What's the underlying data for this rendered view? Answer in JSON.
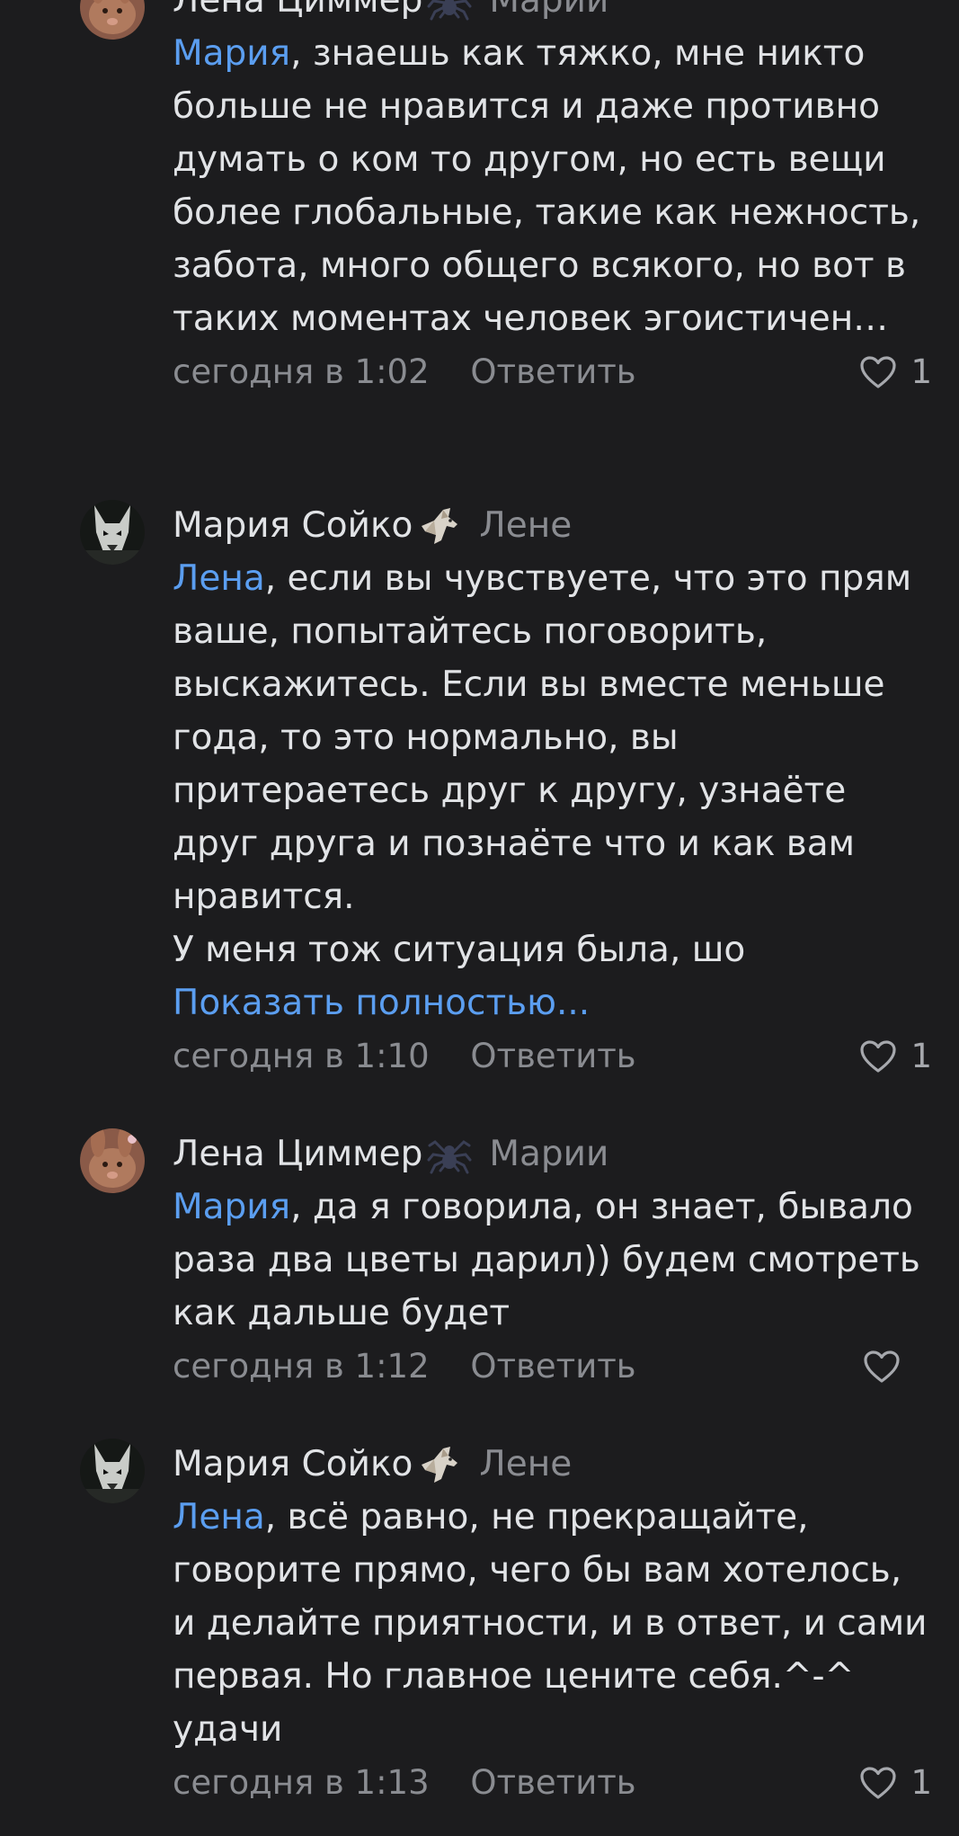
{
  "comments": [
    {
      "author": "Лена Циммер",
      "reply_to": "Марии",
      "mention": "Мария",
      "text": ", знаешь как тяжко, мне никто больше не нравится и даже противно думать о ком то другом, но есть вещи более глобальные, такие как нежность, забота, много общего всякого, но вот в таких моментах человек эгоистичен…",
      "time": "сегодня в 1:02",
      "reply_label": "Ответить",
      "likes": "1",
      "avatar_icon": "rabbit-avatar",
      "badge_icon": "spider-icon"
    },
    {
      "author": "Мария Сойко",
      "reply_to": "Лене",
      "mention": "Лена",
      "text": ", если вы чувствуете, что это прям ваше, попытайтесь поговорить, выскажитесь. Если вы вместе меньше года, то это нормально, вы притераетесь друг к другу, узнаёте друг друга и познаёте что и как вам нравится.\nУ меня тож ситуация была, шо",
      "show_more": "Показать полностью...",
      "time": "сегодня в 1:10",
      "reply_label": "Ответить",
      "likes": "1",
      "avatar_icon": "wolf-avatar",
      "badge_icon": "wolf-icon"
    },
    {
      "author": "Лена Циммер",
      "reply_to": "Марии",
      "mention": "Мария",
      "text": ", да я говорила, он знает, бывало раза два цветы дарил)) будем смотреть как дальше будет",
      "time": "сегодня в 1:12",
      "reply_label": "Ответить",
      "likes": "",
      "avatar_icon": "rabbit-avatar",
      "badge_icon": "spider-icon"
    },
    {
      "author": "Мария Сойко",
      "reply_to": "Лене",
      "mention": "Лена",
      "text": ", всё равно, не прекращайте, говорите прямо, чего бы вам хотелось, и делайте приятности, и в ответ, и сами первая. Но главное цените себя.^-^ удачи",
      "time": "сегодня в 1:13",
      "reply_label": "Ответить",
      "likes": "1",
      "avatar_icon": "wolf-avatar",
      "badge_icon": "wolf-icon"
    }
  ],
  "colors": {
    "background": "#1c1c1e",
    "text": "#e1e3e6",
    "secondary": "#8a8c91",
    "link": "#5b9ef0"
  }
}
